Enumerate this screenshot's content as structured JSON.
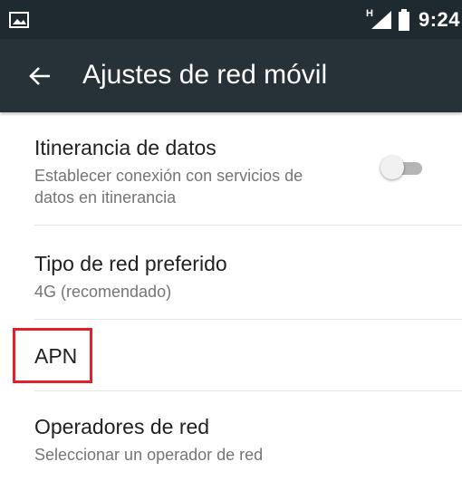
{
  "status_bar": {
    "network_type": "H",
    "time": "9:24",
    "icons": [
      "image-notification-icon",
      "signal-icon",
      "battery-icon"
    ]
  },
  "app_bar": {
    "title": "Ajustes de red móvil",
    "back_icon": "arrow-back-icon"
  },
  "settings": {
    "items": [
      {
        "title": "Itinerancia de datos",
        "subtitle_line1": "Establecer conexión con servicios de",
        "subtitle_line2": "datos en itinerancia",
        "toggle": "off"
      },
      {
        "title": "Tipo de red preferido",
        "subtitle": "4G (recomendado)"
      },
      {
        "title": "APN"
      },
      {
        "title": "Operadores de red",
        "subtitle": "Seleccionar un operador de red"
      }
    ]
  },
  "colors": {
    "status_bar": "#1f2a30",
    "app_bar": "#263238",
    "highlight": "#e0202a",
    "title_text": "#212121",
    "subtitle_text": "#757575"
  }
}
